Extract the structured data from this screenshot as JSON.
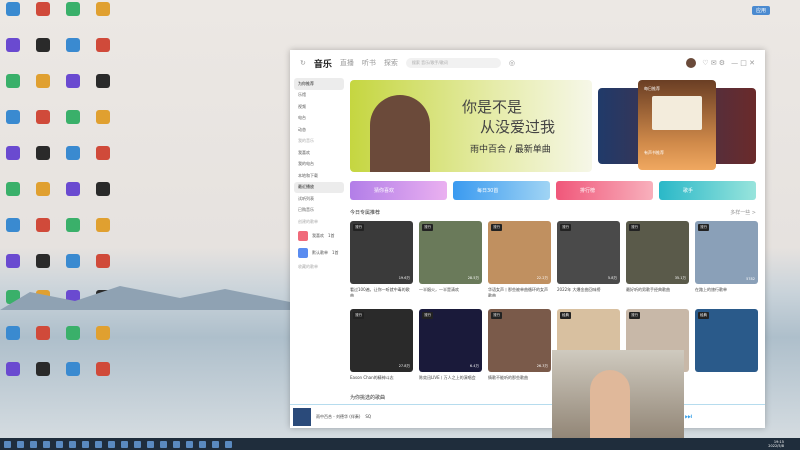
{
  "desktop": {
    "tray_badge": "应用"
  },
  "app": {
    "tabs": [
      "音乐",
      "直播",
      "听书",
      "探索"
    ],
    "search_placeholder": "搜索 音乐/歌手/歌词",
    "sidebar": {
      "items": [
        "为你推荐",
        "乐馆",
        "视频",
        "电台",
        "动态"
      ],
      "my_header": "我的音乐",
      "my_items": [
        "我喜欢",
        "我的电台",
        "本地和下载",
        "最近播放",
        "试听列表",
        "已购音乐"
      ],
      "created_header": "创建的歌单",
      "playlists": [
        {
          "name": "我喜欢",
          "count": "1首"
        },
        {
          "name": "默认歌单",
          "count": "1首"
        }
      ],
      "collected_header": "收藏的歌单"
    },
    "banner": {
      "line1": "你是不是",
      "line2": "从没爱过我",
      "line3": "雨中百合 / 最新单曲"
    },
    "side_card": {
      "title": "每日推荐",
      "caption": "有声书推荐"
    },
    "quick": [
      "猜你喜欢",
      "每日30首",
      "排行榜",
      "歌手"
    ],
    "section_title": "今日专属推荐",
    "section_more": "多样一些 >",
    "cards": [
      {
        "tag": "流行",
        "count": "19.6万",
        "title": "看过100遍，让你一听就中毒的歌曲"
      },
      {
        "tag": "流行",
        "count": "28.5万",
        "title": "一半烟火，一半是清欢"
      },
      {
        "tag": "流行",
        "count": "22.2万",
        "title": "华语女声丨那些被单曲循环的女声歌曲"
      },
      {
        "tag": "流行",
        "count": "5.8万",
        "title": "2022年 大爆金曲回味榜"
      },
      {
        "tag": "流行",
        "count": "35.1万",
        "title": "最好听的男歌手经典歌曲"
      },
      {
        "tag": "流行",
        "count": "5782",
        "title": "在路上的旅行歌单"
      },
      {
        "tag": "流行",
        "count": "27.8万",
        "title": "Eason Chan的精神斗志"
      },
      {
        "tag": "流行",
        "count": "6.4万",
        "title": "陈奕迅LIVE丨万人之上的演唱会"
      },
      {
        "tag": "流行",
        "count": "26.3万",
        "title": "情歌不能听的那些歌曲"
      },
      {
        "tag": "经典",
        "count": "",
        "title": ""
      },
      {
        "tag": "流行",
        "count": "",
        "title": ""
      },
      {
        "tag": "经典",
        "count": "",
        "title": ""
      }
    ],
    "pick_title": "为你挑选的歌曲",
    "player": {
      "song": "雨中百合 - 刘德华 (伴奏)",
      "quality": "SQ"
    }
  },
  "taskbar": {
    "time": "19:15",
    "date": "2022/5/8"
  }
}
